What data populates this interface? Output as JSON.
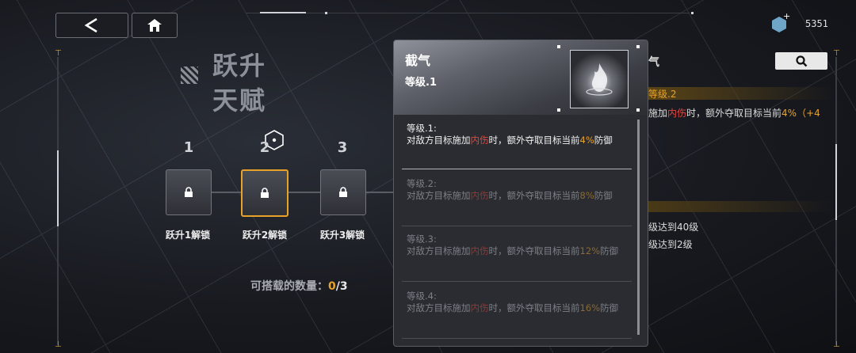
{
  "title": {
    "line1": "跃升",
    "line2": "天赋"
  },
  "currency": {
    "value": "5351",
    "icon": "gem-icon"
  },
  "nodes": [
    {
      "num": "1",
      "label": "跃升1解锁",
      "selected": false
    },
    {
      "num": "2",
      "label": "跃升2解锁",
      "selected": true
    },
    {
      "num": "3",
      "label": "跃升3解锁",
      "selected": false
    }
  ],
  "capacity": {
    "label": "可搭载的数量：",
    "current": "0",
    "total": "/3"
  },
  "right_panel": {
    "name": "气",
    "level": "等级.2",
    "desc_pre": "施加",
    "desc_red": "内伤",
    "desc_mid": "时，额外夺取目标当前",
    "desc_gold": "4%（+4",
    "req1": "级达到40级",
    "req2": "级达到2级"
  },
  "popup": {
    "name": "截气",
    "level": "等级.1",
    "entries": [
      {
        "lv": "等级.1:",
        "pre": "对敌方目标施加",
        "red": "内伤",
        "mid": "时，额外夺取目标当前",
        "gold": "4%",
        "post": "防御",
        "active": true
      },
      {
        "lv": "等级.2:",
        "pre": "对敌方目标施加",
        "red": "内伤",
        "mid": "时，额外夺取目标当前",
        "gold": "8%",
        "post": "防御",
        "active": false
      },
      {
        "lv": "等级.3:",
        "pre": "对敌方目标施加",
        "red": "内伤",
        "mid": "时，额外夺取目标当前",
        "gold": "12%",
        "post": "防御",
        "active": false
      },
      {
        "lv": "等级.4:",
        "pre": "对敌方目标施加",
        "red": "内伤",
        "mid": "时，额外夺取目标当前",
        "gold": "16%",
        "post": "防御",
        "active": false
      }
    ]
  },
  "colors": {
    "accent": "#e8a22a",
    "red": "#e0483e"
  }
}
